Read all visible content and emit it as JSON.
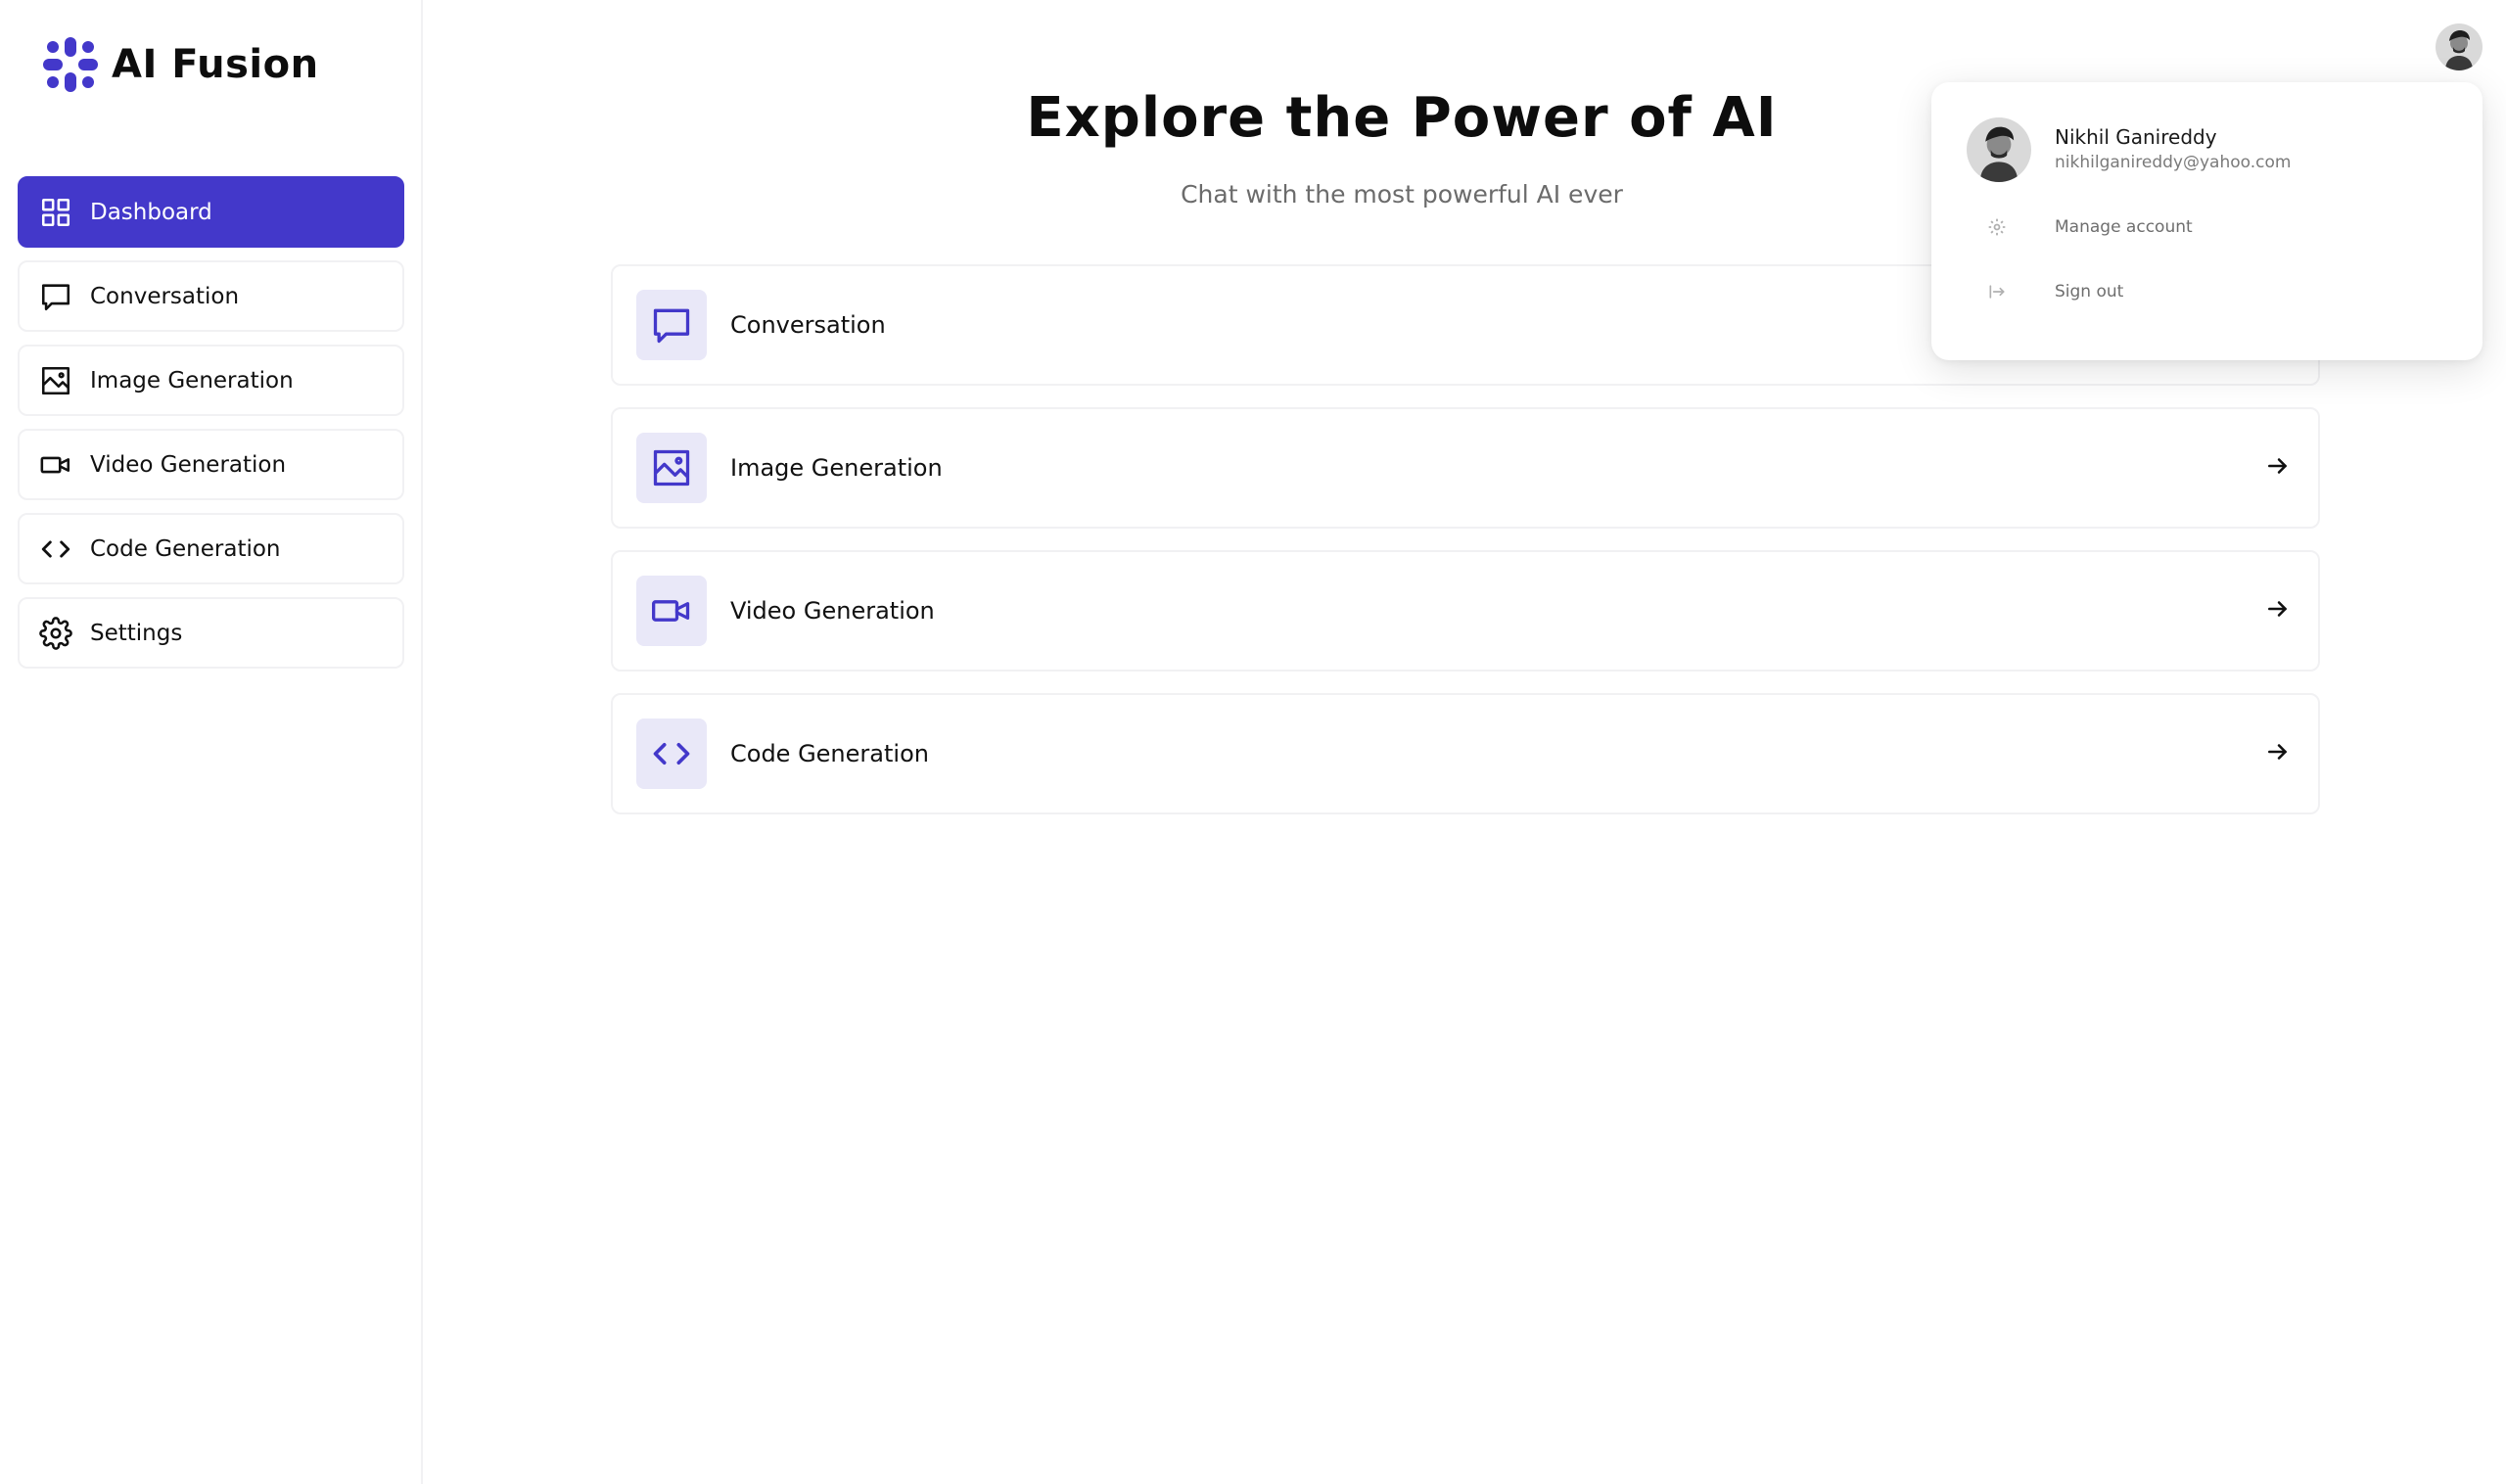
{
  "app": {
    "name": "AI Fusion",
    "accent_color": "#4338ca",
    "accent_soft": "#e9e8f8"
  },
  "sidebar": {
    "items": [
      {
        "label": "Dashboard",
        "icon": "dashboard-grid-icon",
        "active": true
      },
      {
        "label": "Conversation",
        "icon": "chat-bubble-icon",
        "active": false
      },
      {
        "label": "Image Generation",
        "icon": "image-icon",
        "active": false
      },
      {
        "label": "Video Generation",
        "icon": "video-camera-icon",
        "active": false
      },
      {
        "label": "Code Generation",
        "icon": "code-brackets-icon",
        "active": false
      },
      {
        "label": "Settings",
        "icon": "gear-icon",
        "active": false
      }
    ]
  },
  "main": {
    "title": "Explore the Power of AI",
    "subtitle": "Chat with the most powerful AI ever",
    "cards": [
      {
        "label": "Conversation",
        "icon": "chat-bubble-icon"
      },
      {
        "label": "Image Generation",
        "icon": "image-icon"
      },
      {
        "label": "Video Generation",
        "icon": "video-camera-icon"
      },
      {
        "label": "Code Generation",
        "icon": "code-brackets-icon"
      }
    ]
  },
  "user_menu": {
    "name": "Nikhil Ganireddy",
    "email": "nikhilganireddy@yahoo.com",
    "actions": [
      {
        "label": "Manage account",
        "icon": "gear-icon"
      },
      {
        "label": "Sign out",
        "icon": "sign-out-icon"
      }
    ]
  }
}
